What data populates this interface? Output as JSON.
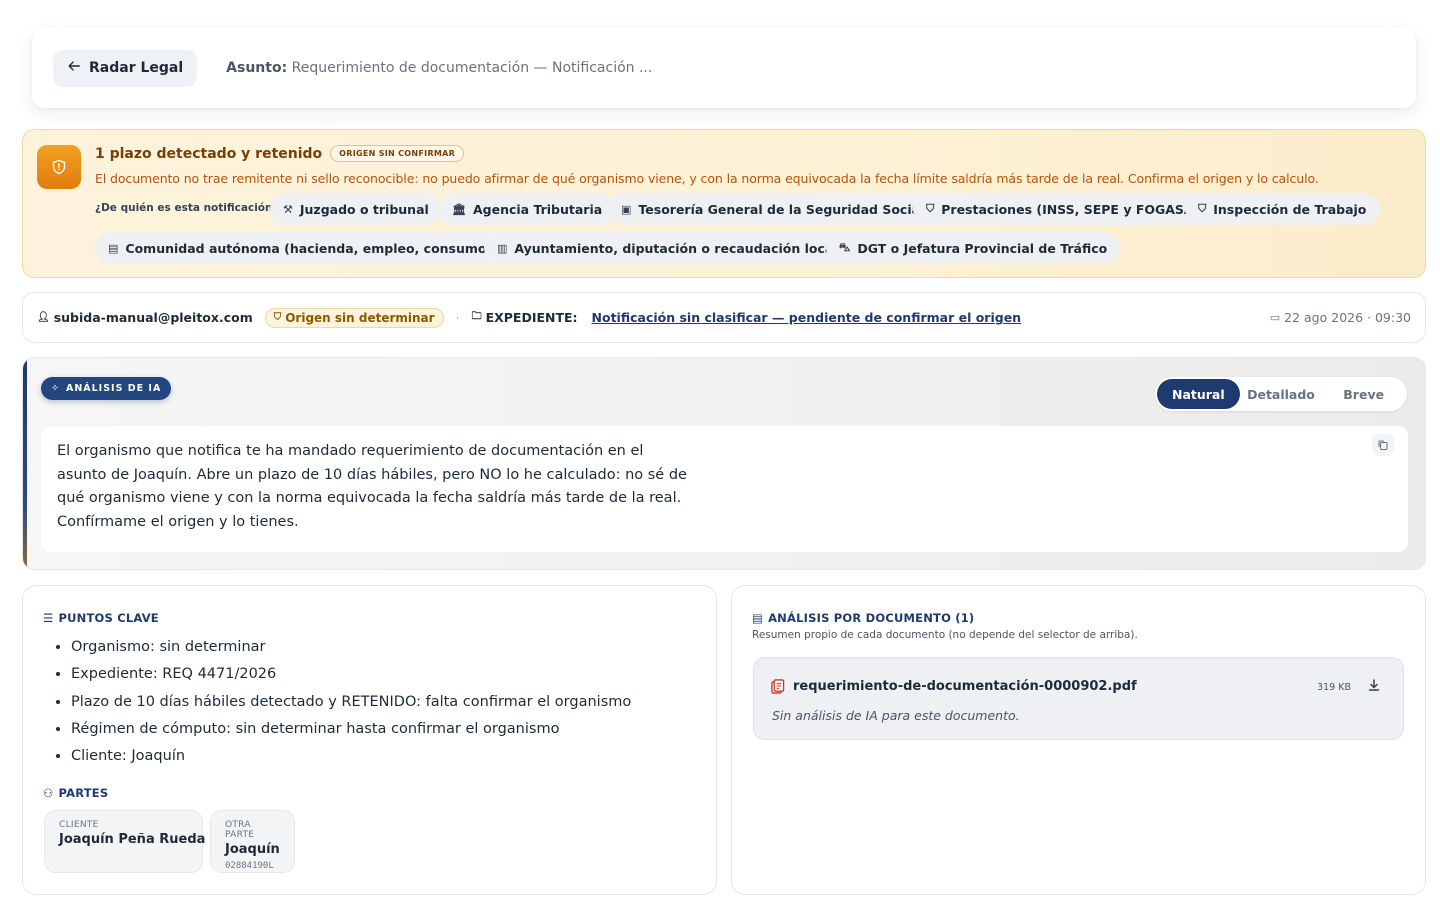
{
  "topbar": {
    "back_label": "Radar Legal",
    "subject_label": "Asunto:",
    "subject_value": "Requerimiento de documentación — Notificación ..."
  },
  "alert": {
    "title": "1 plazo detectado y retenido",
    "badge": "ORIGEN SIN CONFIRMAR",
    "description": "El documento no trae remitente ni sello reconocible: no puedo afirmar de qué organismo viene, y con la norma equivocada la fecha límite saldría más tarde de la real. Confirma el origen y lo calculo.",
    "question": "¿De quién es esta notificación?",
    "options": [
      {
        "label": "Juzgado o tribunal",
        "icon": "gavel-icon"
      },
      {
        "label": "Agencia Tributaria",
        "icon": "bank-icon"
      },
      {
        "label": "Tesorería General de la Seguridad Social",
        "icon": "cash-icon"
      },
      {
        "label": "Prestaciones (INSS, SEPE y FOGASA)",
        "icon": "shield-icon"
      },
      {
        "label": "Inspección de Trabajo",
        "icon": "shield-icon"
      },
      {
        "label": "Comunidad autónoma (hacienda, empleo, consumo)",
        "icon": "document-icon"
      },
      {
        "label": "Ayuntamiento, diputación o recaudación local",
        "icon": "building-icon"
      },
      {
        "label": "DGT o Jefatura Provincial de Tráfico",
        "icon": "car-icon"
      }
    ]
  },
  "meta": {
    "user": "subida-manual@pleitox.com",
    "origin_badge": "Origen sin determinar",
    "separator": "·",
    "expediente_label": "EXPEDIENTE:",
    "expediente_link": "Notificación sin clasificar — pendiente de confirmar el origen",
    "date": "22 ago 2026 · 09:30"
  },
  "ai": {
    "badge": "ANÁLISIS DE IA",
    "modes": [
      "Natural",
      "Detallado",
      "Breve"
    ],
    "active_mode": "Natural",
    "text": "El organismo que notifica te ha mandado requerimiento de documentación en el asunto de Joaquín. Abre un plazo de 10 días hábiles, pero NO lo he calculado: no sé de qué organismo viene y con la norma equivocada la fecha saldría más tarde de la real. Confírmame el origen y lo tienes."
  },
  "key_points": {
    "title": "PUNTOS CLAVE",
    "items": [
      "Organismo: sin determinar",
      "Expediente: REQ 4471/2026",
      "Plazo de 10 días hábiles detectado y RETENIDO: falta confirmar el organismo",
      "Régimen de cómputo: sin determinar hasta confirmar el organismo",
      "Cliente: Joaquín"
    ]
  },
  "parties": {
    "title": "PARTES",
    "items": [
      {
        "role": "CLIENTE",
        "name": "Joaquín Peña Rueda",
        "id": ""
      },
      {
        "role": "OTRA PARTE",
        "name": "Joaquín",
        "id": "02884190L"
      }
    ]
  },
  "documents": {
    "title": "ANÁLISIS POR DOCUMENTO (1)",
    "subtitle": "Resumen propio de cada documento (no depende del selector de arriba).",
    "items": [
      {
        "name": "requerimiento-de-documentación-0000902.pdf",
        "size": "319 KB",
        "analysis": "Sin análisis de IA para este documento."
      }
    ]
  },
  "colors": {
    "primary": "#1e3a6e",
    "warning_bg": "#fdf3dc",
    "warning_text": "#b45309",
    "warning_icon": "#e88a14"
  }
}
